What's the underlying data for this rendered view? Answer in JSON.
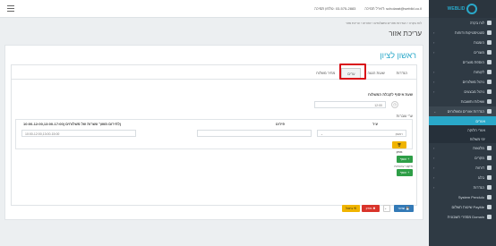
{
  "topbar": {
    "email": "scholarat@weblid.co.il :דוא\"ל תמיכה",
    "phone": "03-575-2883 :טלפון תמיכה"
  },
  "breadcrumb": "לוח בקרה › הגדרות אזורים ומשלוחים › אזורים › עריכת אזור",
  "page_title": "עריכת אזור",
  "panel_title": "ראשון לציון",
  "tabs": [
    "הגדרות",
    "שעות הגעה",
    "ערים",
    "מחיר משלוח"
  ],
  "arrival_label": "שעת איסוף לקבלת המשלוח",
  "arrival_value": "12:00",
  "cities_label": "ערי עוברות",
  "table": {
    "col_city": "עיר",
    "col_desc": "פירוט",
    "col_hours": "(לחירום משוך עשרות של משלוחים (10:00-12:00,13:00-17:00",
    "city_value": "ראשון",
    "hours_value": "10:00-12:00,13:00-15:00"
  },
  "delete_label": "מחק",
  "add_label": "הוסף",
  "additional_label": "תיקוני ערבויות",
  "add2_label": "הוסף",
  "save_label": "שמור",
  "delete_page_label": "מחק",
  "cancel_label": "ביטול",
  "sidebar": {
    "brand": "WEBLID",
    "items": [
      "לוח בקרה",
      "סטטיסטיקות ודוחות",
      "הזמנות",
      "מוצרים",
      "הוספת מוצרים",
      "לקוחות",
      "ניהול משלוחים",
      "ניהול מבצעים",
      "שאלות ותשובות",
      "הגדרות אזורים ומשלוחים",
      "אזורים",
      "אזורי חלוקה",
      "ימי משלוח",
      "מלגאות",
      "מקרים",
      "דוחות",
      "בלוג",
      "הגדרות",
      "System Pendulo",
      "PayMe שיטות תשלום",
      "Domain מספרי חשבונית"
    ]
  }
}
